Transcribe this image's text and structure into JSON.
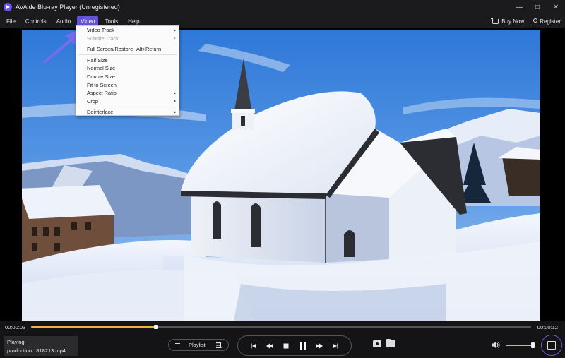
{
  "window": {
    "title": "AVAide Blu-ray Player (Unregistered)",
    "controls": {
      "minimize": "—",
      "maximize": "□",
      "close": "✕"
    }
  },
  "menubar": {
    "items": [
      {
        "label": "File"
      },
      {
        "label": "Controls"
      },
      {
        "label": "Audio"
      },
      {
        "label": "Video",
        "active": true
      },
      {
        "label": "Tools"
      },
      {
        "label": "Help"
      }
    ],
    "right": {
      "buy_now": "Buy Now",
      "register": "Register"
    }
  },
  "video_menu": {
    "items": [
      {
        "label": "Video Track",
        "submenu": true
      },
      {
        "label": "Subtitle Track",
        "submenu": true,
        "disabled": true
      },
      {
        "separator": true
      },
      {
        "label": "Full Screen/Restore",
        "shortcut": "Alt+Return"
      },
      {
        "separator": true
      },
      {
        "label": "Half Size"
      },
      {
        "label": "Normal Size"
      },
      {
        "label": "Double Size"
      },
      {
        "label": "Fit to Screen"
      },
      {
        "label": "Aspect Ratio",
        "submenu": true
      },
      {
        "label": "Crop",
        "submenu": true
      },
      {
        "separator": true
      },
      {
        "label": "Deinterlace",
        "submenu": true
      }
    ]
  },
  "player": {
    "current_time": "00:00:03",
    "total_time": "00:00:12",
    "progress_fraction": 0.25,
    "volume_fraction": 0.92,
    "now_playing_label": "Playing:",
    "now_playing_file": "production...818213.mp4",
    "playlist_label": "Playlist"
  },
  "colors": {
    "accent": "#6454d8",
    "progress": "#f0b43a",
    "bar_background": "#1b1b1d"
  },
  "icons": {
    "pointer": "arrow-pointer-icon",
    "transport": [
      "previous-icon",
      "rewind-icon",
      "stop-icon",
      "pause-icon",
      "fast-forward-icon",
      "next-icon"
    ]
  }
}
